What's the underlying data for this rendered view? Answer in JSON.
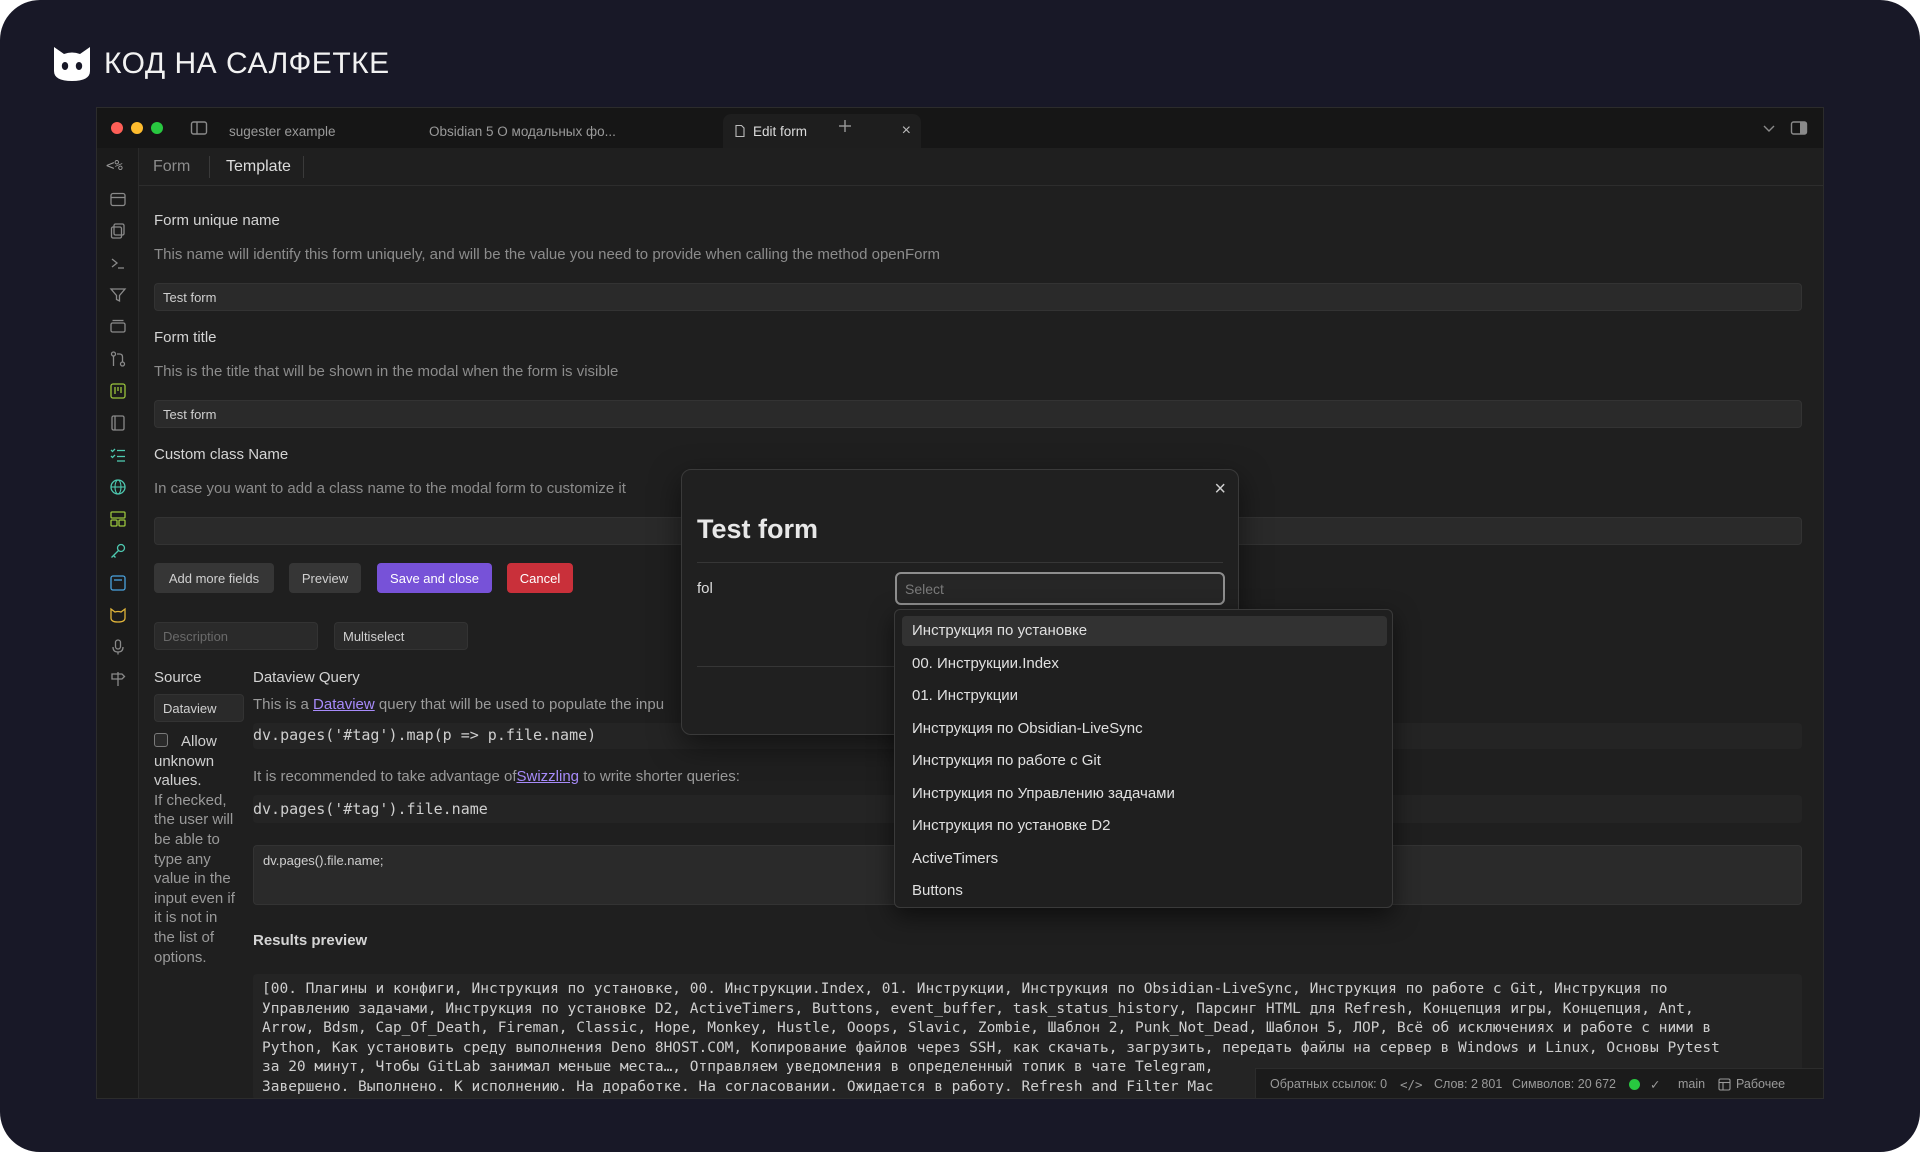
{
  "brand": {
    "name": "КОД НА САЛФЕТКЕ",
    "icon": "cat-logo-icon"
  },
  "titlebar": {
    "tabs": [
      {
        "label": "sugester example"
      },
      {
        "label": "Obsidian 5 О модальных фо..."
      },
      {
        "label": "Edit form"
      }
    ]
  },
  "view_tabs": {
    "form": "Form",
    "template": "Template"
  },
  "form": {
    "unique_name_label": "Form unique name",
    "unique_name_desc": "This name will identify this form uniquely, and will be the value you need to provide when calling the method openForm",
    "unique_name_value": "Test form",
    "title_label": "Form title",
    "title_desc": "This is the title that will be shown in the modal when the form is visible",
    "title_value": "Test form",
    "class_label": "Custom class Name",
    "class_desc": "In case you want to add a class name to the modal form to customize it",
    "class_value": ""
  },
  "buttons": {
    "add_fields": "Add more fields",
    "preview": "Preview",
    "save_close": "Save and close",
    "cancel": "Cancel"
  },
  "field_row": {
    "description_placeholder": "Description",
    "type_value": "Multiselect"
  },
  "source": {
    "label": "Source",
    "value": "Dataview",
    "allow_unknown": [
      "Allow",
      "unknown",
      "values.",
      "If checked,",
      "the user will",
      "be able to",
      "type any",
      "value in the",
      "input even if",
      "it is not in",
      "the list of",
      "options."
    ]
  },
  "dataview": {
    "title": "Dataview Query",
    "desc_prefix": "This is a ",
    "desc_link": "Dataview",
    "desc_suffix": " query that will be used to populate the inpu",
    "code1": "dv.pages('#tag').map(p => p.file.name)",
    "rec_prefix": "It is recommended to take advantage of",
    "rec_link": "Swizzling",
    "rec_suffix": " to write shorter queries:",
    "code2": "dv.pages('#tag').file.name",
    "query_value": "dv.pages().file.name;"
  },
  "results": {
    "title": "Results preview",
    "lines": [
      "[00. Плагины и конфиги, Инструкция по установке, 00. Инструкции.Index, 01. Инструкции, Инструкция по Obsidian-LiveSync, Инструкция по работе с Git, Инструкция по",
      "Управлению задачами, Инструкция по установке D2, ActiveTimers, Buttons, event_buffer, task_status_history, Парсинг HTML для Refresh, Концепция игры, Концепция, Ant,",
      "Arrow, Bdsm, Cap_Of_Death, Fireman, Classic, Hope, Monkey, Hustle, Ooops, Slavic, Zombie, Шаблон 2, Punk_Not_Dead, Шаблон 5, ЛОР, Всё об исключениях и работе с ними в",
      "Python, Как установить среду выполнения Deno  8HOST.COM, Копирование файлов через SSH, как скачать, загрузить, передать файлы на сервер в Windows и Linux, Основы Pytest",
      "за 20 минут, Чтобы GitLab занимал меньше места…, Отправляем уведомления в определенный топик в чате Telegram,",
      "Завершено. Выполнено. К исполнению. На доработке. На согласовании. Ожидается в работу. Refresh and Filter Mac"
    ]
  },
  "modal": {
    "title": "Test form",
    "field_label": "fol",
    "select_placeholder": "Select"
  },
  "dropdown": {
    "items": [
      "Инструкция по установке",
      "00. Инструкции.Index",
      "01. Инструкции",
      "Инструкция по Obsidian-LiveSync",
      "Инструкция по работе с Git",
      "Инструкция по Управлению задачами",
      "Инструкция по установке D2",
      "ActiveTimers",
      "Buttons"
    ]
  },
  "statusbar": {
    "backlinks": "Обратных ссылок: 0",
    "words": "Слов: 2 801",
    "chars": "Символов: 20 672",
    "branch": "main",
    "workspace": "Рабочее",
    "sync_color": "#28c840"
  },
  "colors": {
    "accent": "#7752d8",
    "danger": "#c9303a",
    "background": "#181827"
  }
}
